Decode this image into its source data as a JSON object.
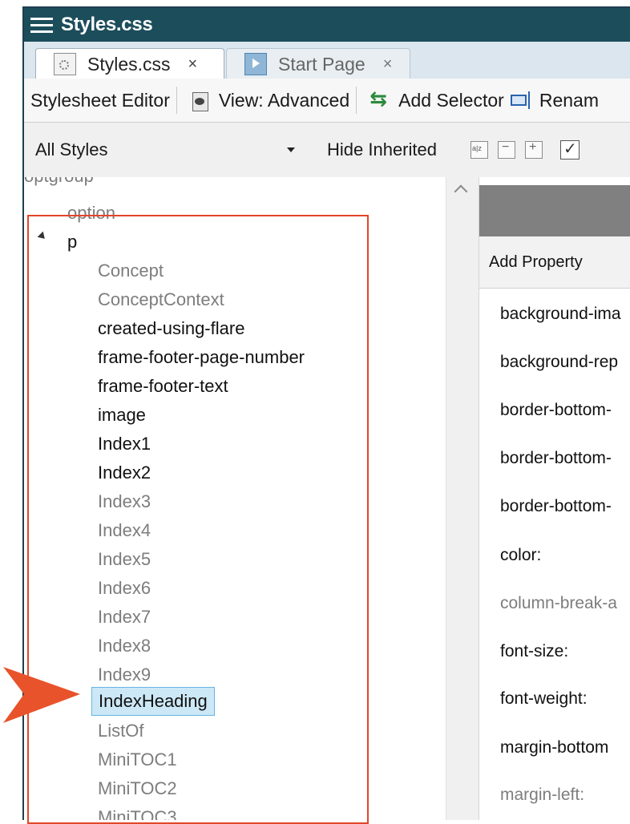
{
  "window": {
    "title": "Styles.css"
  },
  "tabs": [
    {
      "label": "Styles.css",
      "close": "×",
      "active": true,
      "icon": "css-file-icon"
    },
    {
      "label": "Start Page",
      "close": "×",
      "active": false,
      "icon": "start-page-icon"
    }
  ],
  "toolbar": {
    "editor_label": "Stylesheet Editor",
    "view_label": "View: Advanced",
    "add_selector_label": "Add Selector",
    "rename_label": "Renam"
  },
  "filter": {
    "styles_select_value": "All Styles",
    "hide_inherited_label": "Hide Inherited"
  },
  "tree": {
    "cut_item": "optgroup",
    "option_item": "option",
    "parent": "p",
    "children": [
      {
        "label": "Concept",
        "style": "muted"
      },
      {
        "label": "ConceptContext",
        "style": "muted"
      },
      {
        "label": "created-using-flare",
        "style": "strong"
      },
      {
        "label": "frame-footer-page-number",
        "style": "strong"
      },
      {
        "label": "frame-footer-text",
        "style": "strong"
      },
      {
        "label": "image",
        "style": "strong"
      },
      {
        "label": "Index1",
        "style": "strong"
      },
      {
        "label": "Index2",
        "style": "strong"
      },
      {
        "label": "Index3",
        "style": "muted"
      },
      {
        "label": "Index4",
        "style": "muted"
      },
      {
        "label": "Index5",
        "style": "muted"
      },
      {
        "label": "Index6",
        "style": "muted"
      },
      {
        "label": "Index7",
        "style": "muted"
      },
      {
        "label": "Index8",
        "style": "muted"
      },
      {
        "label": "Index9",
        "style": "muted"
      },
      {
        "label": "IndexHeading",
        "style": "selected"
      },
      {
        "label": "ListOf",
        "style": "muted"
      },
      {
        "label": "MiniTOC1",
        "style": "muted"
      },
      {
        "label": "MiniTOC2",
        "style": "muted"
      },
      {
        "label": "MiniTOC3",
        "style": "muted"
      }
    ]
  },
  "properties": {
    "add_property_label": "Add Property",
    "items": [
      {
        "label": "background-ima",
        "style": "strong"
      },
      {
        "label": "background-rep",
        "style": "strong"
      },
      {
        "label": "border-bottom-",
        "style": "strong"
      },
      {
        "label": "border-bottom-",
        "style": "strong"
      },
      {
        "label": "border-bottom-",
        "style": "strong"
      },
      {
        "label": "color:",
        "style": "strong"
      },
      {
        "label": "column-break-a",
        "style": "muted"
      },
      {
        "label": "font-size:",
        "style": "strong"
      },
      {
        "label": "font-weight:",
        "style": "strong"
      },
      {
        "label": "margin-bottom",
        "style": "strong"
      },
      {
        "label": "margin-left:",
        "style": "muted"
      }
    ]
  },
  "colors": {
    "titlebar": "#1c4d5b",
    "highlight_box": "#e2462a",
    "pointer_arrow": "#e8532b",
    "selection_bg": "#cce8f7",
    "selection_border": "#67b6e2",
    "muted_text": "#7d7d7d"
  }
}
